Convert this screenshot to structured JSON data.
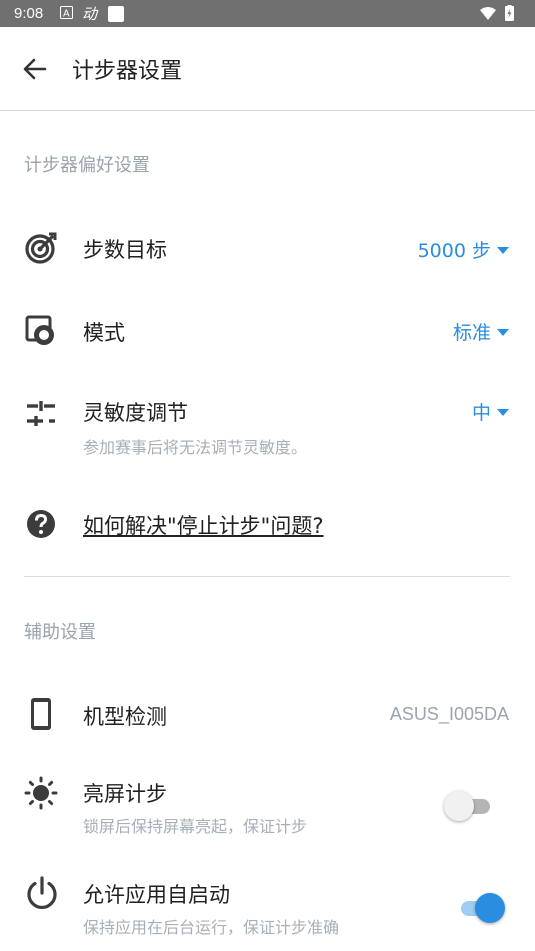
{
  "status_bar": {
    "time": "9:08",
    "app_glyph": "动"
  },
  "header": {
    "title": "计步器设置"
  },
  "sections": {
    "pedometer_prefs": "计步器偏好设置",
    "aux": "辅助设置"
  },
  "rows": {
    "step_goal": {
      "title": "步数目标",
      "value": "5000 步",
      "icon": "target-icon"
    },
    "mode": {
      "title": "模式",
      "value": "标准",
      "icon": "mode-icon"
    },
    "sensitivity": {
      "title": "灵敏度调节",
      "value": "中",
      "subtitle": "参加赛事后将无法调节灵敏度。",
      "icon": "tune-icon"
    },
    "help": {
      "title": "如何解决\"停止计步\"问题?",
      "icon": "help-icon"
    },
    "device": {
      "title": "机型检测",
      "value": "ASUS_I005DA",
      "icon": "phone-icon"
    },
    "screen_on": {
      "title": "亮屏计步",
      "subtitle": "锁屏后保持屏幕亮起，保证计步",
      "enabled": false,
      "icon": "brightness-icon"
    },
    "autostart": {
      "title": "允许应用自启动",
      "subtitle": "保持应用在后台运行，保证计步准确",
      "enabled": true,
      "icon": "power-icon"
    }
  },
  "colors": {
    "accent": "#2b8de0",
    "status_bar": "#707070",
    "muted": "#9aa4ad"
  }
}
